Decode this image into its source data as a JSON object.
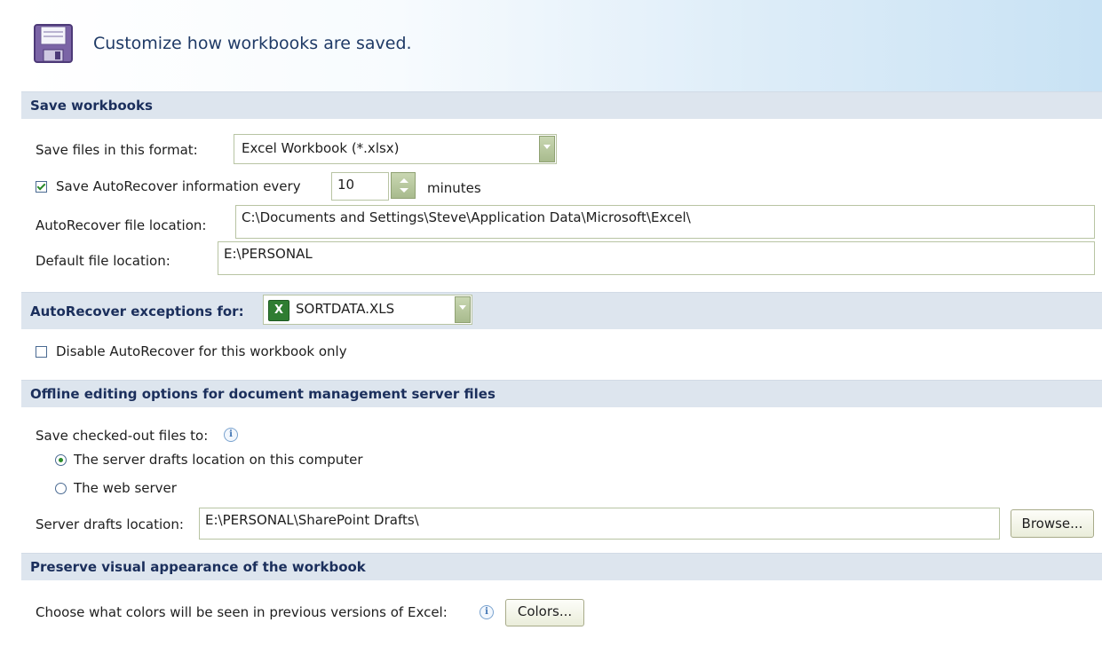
{
  "header": {
    "title": "Customize how workbooks are saved."
  },
  "icons": {
    "save": "floppy-disk-icon",
    "info": "info-icon",
    "excel": "excel-file-icon"
  },
  "colors": {
    "section_bg": "#dde5ee",
    "section_text": "#1b2f5c",
    "check_green": "#2a8a2a"
  },
  "sections": {
    "save": {
      "title": "Save workbooks"
    },
    "exceptions": {
      "title": "AutoRecover exceptions for:"
    },
    "offline": {
      "title": "Offline editing options for document management server files"
    },
    "preserve": {
      "title": "Preserve visual appearance of the workbook"
    }
  },
  "save": {
    "format_label": "Save files in this format:",
    "format_value": "Excel Workbook (*.xlsx)",
    "autorecover_label": "Save AutoRecover information every",
    "autorecover_checked": true,
    "autorecover_minutes": "10",
    "minutes_label": "minutes",
    "autorecover_location_label": "AutoRecover file location:",
    "autorecover_location_value": "C:\\Documents and Settings\\Steve\\Application Data\\Microsoft\\Excel\\",
    "default_location_label": "Default file location:",
    "default_location_value": "E:\\PERSONAL"
  },
  "exceptions": {
    "workbook": "SORTDATA.XLS",
    "disable_label": "Disable AutoRecover for this workbook only",
    "disable_checked": false
  },
  "offline": {
    "save_to_label": "Save checked-out files to:",
    "option_server_drafts": "The server drafts location on this computer",
    "option_web_server": "The web server",
    "selected": "server_drafts",
    "drafts_location_label": "Server drafts location:",
    "drafts_location_value": "E:\\PERSONAL\\SharePoint Drafts\\",
    "browse_label": "Browse..."
  },
  "preserve": {
    "colors_label": "Choose what colors will be seen in previous versions of Excel:",
    "colors_button": "Colors..."
  }
}
